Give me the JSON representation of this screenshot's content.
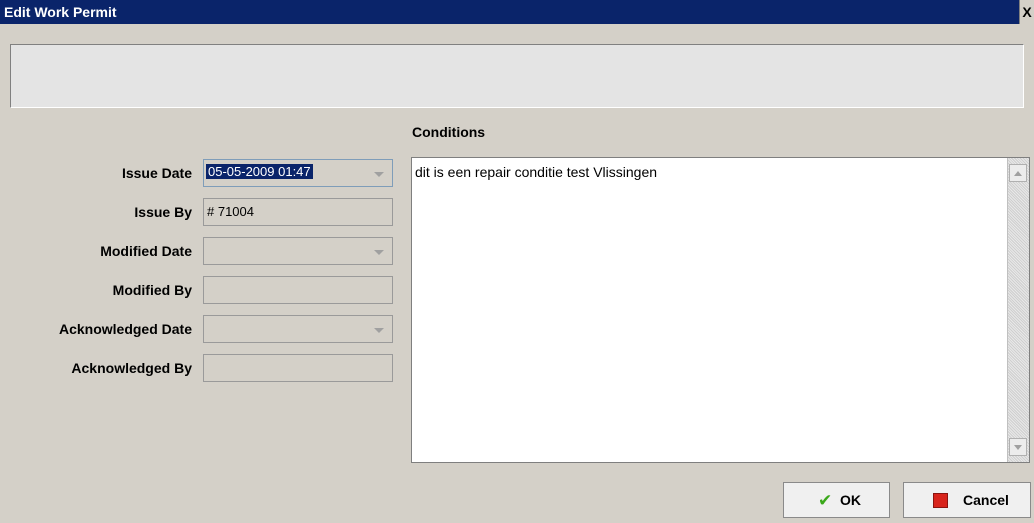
{
  "window": {
    "title": "Edit Work Permit",
    "close_glyph": "X"
  },
  "form": {
    "issue_date": {
      "label": "Issue Date",
      "value": "05-05-2009 01:47"
    },
    "issue_by": {
      "label": "Issue By",
      "value": "# 71004"
    },
    "modified_date": {
      "label": "Modified Date",
      "value": ""
    },
    "modified_by": {
      "label": "Modified By",
      "value": ""
    },
    "acknowledged_date": {
      "label": "Acknowledged Date",
      "value": ""
    },
    "acknowledged_by": {
      "label": "Acknowledged By",
      "value": ""
    }
  },
  "conditions": {
    "heading": "Conditions",
    "text": "dit is een repair conditie test Vlissingen"
  },
  "buttons": {
    "ok": "OK",
    "cancel": "Cancel"
  },
  "icons": {
    "ok": "checkmark-icon",
    "cancel": "red-square-icon",
    "close": "close-icon"
  }
}
